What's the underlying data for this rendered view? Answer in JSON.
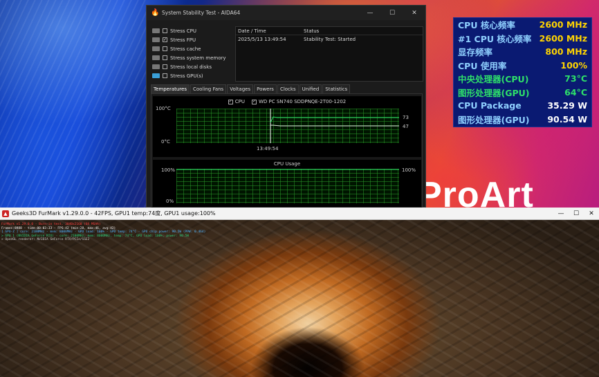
{
  "wallpaper": {
    "brand_text": "ProArt"
  },
  "aida": {
    "title": "System Stability Test - AIDA64",
    "window_buttons": [
      "—",
      "☐",
      "✕"
    ],
    "stress": [
      {
        "label": "Stress CPU",
        "checked": false
      },
      {
        "label": "Stress FPU",
        "checked": true
      },
      {
        "label": "Stress cache",
        "checked": false
      },
      {
        "label": "Stress system memory",
        "checked": false
      },
      {
        "label": "Stress local disks",
        "checked": false
      },
      {
        "label": "Stress GPU(s)",
        "checked": false
      }
    ],
    "log": {
      "col_datetime": "Date / Time",
      "col_status": "Status",
      "row_datetime": "2025/5/13 13:49:54",
      "row_status": "Stability Test: Started"
    },
    "tabs": [
      "Temperatures",
      "Cooling Fans",
      "Voltages",
      "Powers",
      "Clocks",
      "Unified",
      "Statistics"
    ],
    "active_tab": "Temperatures",
    "temp_graph": {
      "legend_cpu": "CPU",
      "legend_disk": "WD PC SN740 SDDPNQE-2T00-1202",
      "y_top": "100°C",
      "y_bottom": "0°C",
      "time_label": "13:49:54",
      "val_cpu": "73",
      "val_disk": "47"
    },
    "usage_graph": {
      "title": "CPU Usage",
      "y_top": "100%",
      "y_bottom": "0%",
      "val_right": "100%"
    }
  },
  "osd": {
    "label_color": "#8fd0ff",
    "rows": [
      {
        "label": "CPU 核心频率",
        "value": "2600 MHz",
        "color": "#ffd400"
      },
      {
        "label": "#1 CPU 核心频率",
        "value": "2600 MHz",
        "color": "#ffd400"
      },
      {
        "label": "显存频率",
        "value": "800 MHz",
        "color": "#ffd400"
      },
      {
        "label": "CPU 使用率",
        "value": "100%",
        "color": "#ffd400"
      },
      {
        "label": "中央处理器(CPU)",
        "value": "73°C",
        "color": "#2ee06a"
      },
      {
        "label": "图形处理器(GPU)",
        "value": "64°C",
        "color": "#2ee06a"
      },
      {
        "label": "CPU Package",
        "value": "35.29 W",
        "color": "#ffffff"
      },
      {
        "label": "图形处理器(GPU)",
        "value": "90.54 W",
        "color": "#ffffff"
      }
    ]
  },
  "furmark": {
    "title": "Geeks3D FurMark v1.29.0.0 - 42FPS, GPU1 temp:74度, GPU1 usage:100%",
    "window_buttons": [
      "—",
      "☐",
      "✕"
    ],
    "osd_lines": [
      {
        "text": "FurMark v1.29.0.0 - Burn-in test, 3840x2160 (0X MSAA)",
        "color": "#ff4040"
      },
      {
        "text": "Frames:8988 - time:00:03:33 - FPS:42 (min:28, max:46, avg:42)",
        "color": "#ffffff"
      },
      {
        "text": "[ GPU-Z ] core: 2100MHz - mem: 8000MHz - GPU load: 100% - GPU temp: 74°C - GPU chip power: 90.5W (PPW: 0.464)",
        "color": "#4fb4ff"
      },
      {
        "text": "> GPU 1 (NVIDIA GeForce RTX) - core: 2100MHz, mem: 8000MHz, temp: 74°C, GPU load: 100%, power: 90.5W",
        "color": "#29d47a"
      },
      {
        "text": "> OpenGL renderer: NVIDIA GeForce RTX/PCIe/SSE2",
        "color": "#cfcfcf"
      }
    ]
  }
}
